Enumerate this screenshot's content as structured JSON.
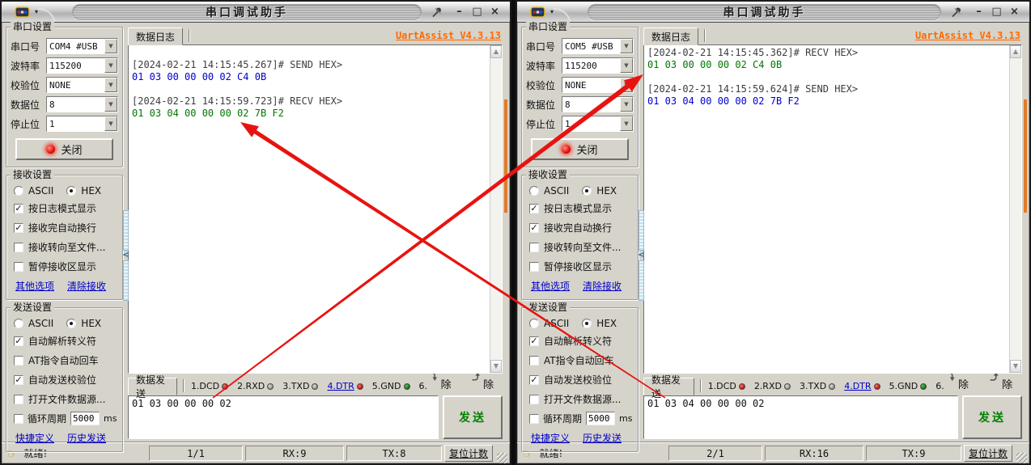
{
  "annotations": {
    "arrow_color": "#e81310",
    "arrows": [
      {
        "from": "left-send-input",
        "to": "right-recv-log-line"
      },
      {
        "from": "right-send-input",
        "to": "left-recv-log-line"
      }
    ]
  },
  "windows": [
    {
      "titlebar": {
        "title": "串口调试助手",
        "minimize": "–",
        "maximize": "□",
        "close": "×",
        "caret": "▾"
      },
      "serial": {
        "group_label": "串口设置",
        "fields": [
          {
            "label": "串口号",
            "value": "COM4 #USB"
          },
          {
            "label": "波特率",
            "value": "115200"
          },
          {
            "label": "校验位",
            "value": "NONE"
          },
          {
            "label": "数据位",
            "value": "8"
          },
          {
            "label": "停止位",
            "value": "1"
          }
        ],
        "close_button": "关闭"
      },
      "recv": {
        "group_label": "接收设置",
        "radio_ascii": "ASCII",
        "radio_hex": "HEX",
        "options": [
          {
            "label": "按日志模式显示",
            "state": "checked"
          },
          {
            "label": "接收完自动换行",
            "state": "checked"
          },
          {
            "label": "接收转向至文件...",
            "state": "unchecked"
          },
          {
            "label": "暂停接收区显示",
            "state": "unchecked"
          }
        ],
        "links": [
          "其他选项",
          "清除接收"
        ]
      },
      "send": {
        "group_label": "发送设置",
        "radio_ascii": "ASCII",
        "radio_hex": "HEX",
        "options": [
          {
            "label": "自动解析转义符",
            "state": "checked"
          },
          {
            "label": "AT指令自动回车",
            "state": "unchecked"
          },
          {
            "label": "自动发送校验位",
            "state": "checked"
          },
          {
            "label": "打开文件数据源...",
            "state": "unchecked"
          }
        ],
        "cycle": {
          "label": "循环周期",
          "state": "unchecked",
          "value": "5000",
          "unit": "ms"
        },
        "links": [
          "快捷定义",
          "历史发送"
        ]
      },
      "log": {
        "tab": "数据日志",
        "version_link": "UartAssist V4.3.13",
        "scroll_up": "▲",
        "scroll_down": "▼",
        "lines": [
          {
            "text": "",
            "color": ""
          },
          {
            "text": "[2024-02-21 14:15:45.267]# SEND HEX>",
            "color": "ts"
          },
          {
            "text": "01 03 00 00 00 02 C4 0B",
            "color": "tx"
          },
          {
            "text": "",
            "color": ""
          },
          {
            "text": "[2024-02-21 14:15:59.723]# RECV HEX>",
            "color": "ts"
          },
          {
            "text": "01 03 04 00 00 00 02 7B F2",
            "color": "rx"
          }
        ]
      },
      "transmit": {
        "tab": "数据发送",
        "leds": [
          {
            "label": "1.DCD",
            "color": "led-red"
          },
          {
            "label": "2.RXD",
            "color": "led-gray"
          },
          {
            "label": "3.TXD",
            "color": "led-gray"
          },
          {
            "label": "4.DTR",
            "color": "led-red",
            "link": "link"
          },
          {
            "label": "5.GND",
            "color": "led-green"
          },
          {
            "label": "6.",
            "color": "led-none"
          }
        ],
        "clear_recv": "清除",
        "clear_send": "清除",
        "input_value": "01 03 00 00 00 02",
        "send_button": "发送"
      },
      "status": {
        "ready": "就绪!",
        "ready_icon": "☞",
        "page": "1/1",
        "rx": "RX:9",
        "tx": "TX:8",
        "reset_button": "复位计数"
      }
    },
    {
      "titlebar": {
        "title": "串口调试助手",
        "minimize": "–",
        "maximize": "□",
        "close": "×",
        "caret": "▾"
      },
      "serial": {
        "group_label": "串口设置",
        "fields": [
          {
            "label": "串口号",
            "value": "COM5 #USB"
          },
          {
            "label": "波特率",
            "value": "115200"
          },
          {
            "label": "校验位",
            "value": "NONE"
          },
          {
            "label": "数据位",
            "value": "8"
          },
          {
            "label": "停止位",
            "value": "1"
          }
        ],
        "close_button": "关闭"
      },
      "recv": {
        "group_label": "接收设置",
        "radio_ascii": "ASCII",
        "radio_hex": "HEX",
        "options": [
          {
            "label": "按日志模式显示",
            "state": "checked"
          },
          {
            "label": "接收完自动换行",
            "state": "checked"
          },
          {
            "label": "接收转向至文件...",
            "state": "unchecked"
          },
          {
            "label": "暂停接收区显示",
            "state": "unchecked"
          }
        ],
        "links": [
          "其他选项",
          "清除接收"
        ]
      },
      "send": {
        "group_label": "发送设置",
        "radio_ascii": "ASCII",
        "radio_hex": "HEX",
        "options": [
          {
            "label": "自动解析转义符",
            "state": "checked"
          },
          {
            "label": "AT指令自动回车",
            "state": "unchecked"
          },
          {
            "label": "自动发送校验位",
            "state": "checked"
          },
          {
            "label": "打开文件数据源...",
            "state": "unchecked"
          }
        ],
        "cycle": {
          "label": "循环周期",
          "state": "unchecked",
          "value": "5000",
          "unit": "ms"
        },
        "links": [
          "快捷定义",
          "历史发送"
        ]
      },
      "log": {
        "tab": "数据日志",
        "version_link": "UartAssist V4.3.13",
        "scroll_up": "▲",
        "scroll_down": "▼",
        "lines": [
          {
            "text": "[2024-02-21 14:15:45.362]# RECV HEX>",
            "color": "ts"
          },
          {
            "text": "01 03 00 00 00 02 C4 0B",
            "color": "rx"
          },
          {
            "text": "",
            "color": ""
          },
          {
            "text": "[2024-02-21 14:15:59.624]# SEND HEX>",
            "color": "ts"
          },
          {
            "text": "01 03 04 00 00 00 02 7B F2",
            "color": "tx"
          }
        ]
      },
      "transmit": {
        "tab": "数据发送",
        "leds": [
          {
            "label": "1.DCD",
            "color": "led-red"
          },
          {
            "label": "2.RXD",
            "color": "led-gray"
          },
          {
            "label": "3.TXD",
            "color": "led-gray"
          },
          {
            "label": "4.DTR",
            "color": "led-red",
            "link": "link"
          },
          {
            "label": "5.GND",
            "color": "led-green"
          },
          {
            "label": "6.",
            "color": "led-none"
          }
        ],
        "clear_recv": "清除",
        "clear_send": "清除",
        "input_value": "01 03 04 00 00 00 02",
        "send_button": "发送"
      },
      "status": {
        "ready": "就绪!",
        "ready_icon": "☞",
        "page": "2/1",
        "rx": "RX:16",
        "tx": "TX:9",
        "reset_button": "复位计数"
      }
    }
  ]
}
